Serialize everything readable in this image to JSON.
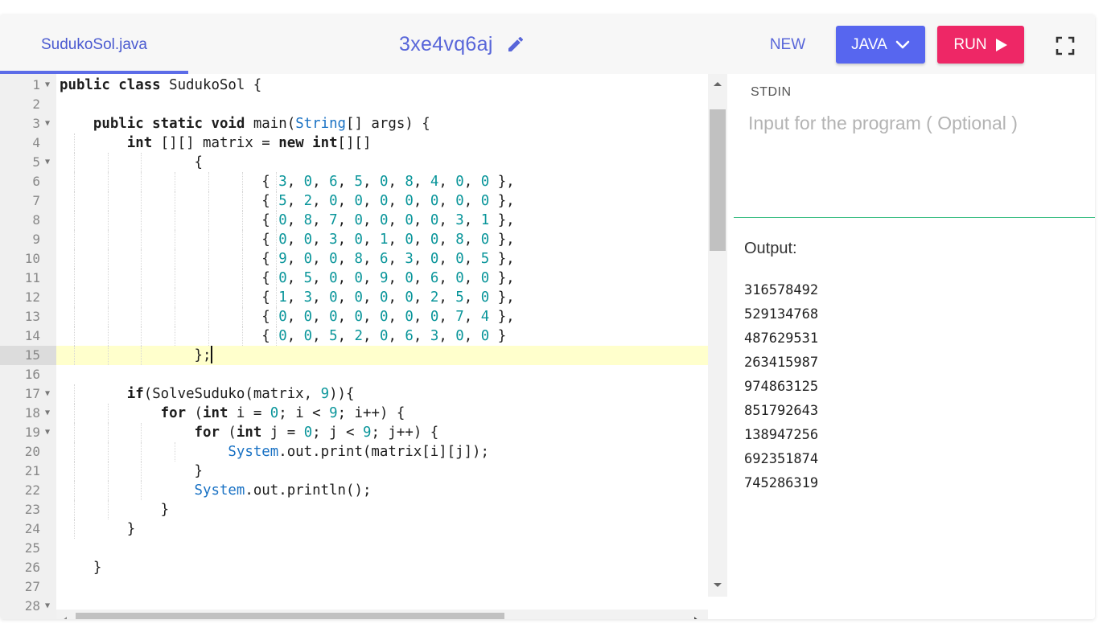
{
  "header": {
    "file_tab": "SudukoSol.java",
    "title": "3xe4vq6aj",
    "new_label": "NEW",
    "language_label": "JAVA",
    "run_label": "RUN"
  },
  "editor": {
    "active_line": 15,
    "lines": [
      {
        "n": "1",
        "fold": true,
        "indent": 0,
        "html": "<span class=\"kw\">public class</span> SudukoSol {"
      },
      {
        "n": "2",
        "fold": false,
        "indent": 0,
        "html": ""
      },
      {
        "n": "3",
        "fold": true,
        "indent": 1,
        "html": "    <span class=\"kw\">public static void</span> main(<span class=\"cls\">String</span>[] args) {"
      },
      {
        "n": "4",
        "fold": false,
        "indent": 2,
        "html": "        <span class=\"kw\">int</span> [][] matrix = <span class=\"kw\">new int</span>[][]"
      },
      {
        "n": "5",
        "fold": true,
        "indent": 4,
        "html": "                {"
      },
      {
        "n": "6",
        "fold": false,
        "indent": 8,
        "html": "                        { <span class=\"num\">3</span>, <span class=\"num\">0</span>, <span class=\"num\">6</span>, <span class=\"num\">5</span>, <span class=\"num\">0</span>, <span class=\"num\">8</span>, <span class=\"num\">4</span>, <span class=\"num\">0</span>, <span class=\"num\">0</span> },"
      },
      {
        "n": "7",
        "fold": false,
        "indent": 8,
        "html": "                        { <span class=\"num\">5</span>, <span class=\"num\">2</span>, <span class=\"num\">0</span>, <span class=\"num\">0</span>, <span class=\"num\">0</span>, <span class=\"num\">0</span>, <span class=\"num\">0</span>, <span class=\"num\">0</span>, <span class=\"num\">0</span> },"
      },
      {
        "n": "8",
        "fold": false,
        "indent": 8,
        "html": "                        { <span class=\"num\">0</span>, <span class=\"num\">8</span>, <span class=\"num\">7</span>, <span class=\"num\">0</span>, <span class=\"num\">0</span>, <span class=\"num\">0</span>, <span class=\"num\">0</span>, <span class=\"num\">3</span>, <span class=\"num\">1</span> },"
      },
      {
        "n": "9",
        "fold": false,
        "indent": 8,
        "html": "                        { <span class=\"num\">0</span>, <span class=\"num\">0</span>, <span class=\"num\">3</span>, <span class=\"num\">0</span>, <span class=\"num\">1</span>, <span class=\"num\">0</span>, <span class=\"num\">0</span>, <span class=\"num\">8</span>, <span class=\"num\">0</span> },"
      },
      {
        "n": "10",
        "fold": false,
        "indent": 8,
        "html": "                        { <span class=\"num\">9</span>, <span class=\"num\">0</span>, <span class=\"num\">0</span>, <span class=\"num\">8</span>, <span class=\"num\">6</span>, <span class=\"num\">3</span>, <span class=\"num\">0</span>, <span class=\"num\">0</span>, <span class=\"num\">5</span> },"
      },
      {
        "n": "11",
        "fold": false,
        "indent": 8,
        "html": "                        { <span class=\"num\">0</span>, <span class=\"num\">5</span>, <span class=\"num\">0</span>, <span class=\"num\">0</span>, <span class=\"num\">9</span>, <span class=\"num\">0</span>, <span class=\"num\">6</span>, <span class=\"num\">0</span>, <span class=\"num\">0</span> },"
      },
      {
        "n": "12",
        "fold": false,
        "indent": 8,
        "html": "                        { <span class=\"num\">1</span>, <span class=\"num\">3</span>, <span class=\"num\">0</span>, <span class=\"num\">0</span>, <span class=\"num\">0</span>, <span class=\"num\">0</span>, <span class=\"num\">2</span>, <span class=\"num\">5</span>, <span class=\"num\">0</span> },"
      },
      {
        "n": "13",
        "fold": false,
        "indent": 8,
        "html": "                        { <span class=\"num\">0</span>, <span class=\"num\">0</span>, <span class=\"num\">0</span>, <span class=\"num\">0</span>, <span class=\"num\">0</span>, <span class=\"num\">0</span>, <span class=\"num\">0</span>, <span class=\"num\">7</span>, <span class=\"num\">4</span> },"
      },
      {
        "n": "14",
        "fold": false,
        "indent": 8,
        "html": "                        { <span class=\"num\">0</span>, <span class=\"num\">0</span>, <span class=\"num\">5</span>, <span class=\"num\">2</span>, <span class=\"num\">0</span>, <span class=\"num\">6</span>, <span class=\"num\">3</span>, <span class=\"num\">0</span>, <span class=\"num\">0</span> }"
      },
      {
        "n": "15",
        "fold": false,
        "indent": 4,
        "html": "                };<span class=\"cursor\"></span>"
      },
      {
        "n": "16",
        "fold": false,
        "indent": 0,
        "html": ""
      },
      {
        "n": "17",
        "fold": true,
        "indent": 2,
        "html": "        <span class=\"kw\">if</span>(SolveSuduko(matrix, <span class=\"num\">9</span>)){"
      },
      {
        "n": "18",
        "fold": true,
        "indent": 3,
        "html": "            <span class=\"kw\">for</span> (<span class=\"kw\">int</span> i = <span class=\"num\">0</span>; i &lt; <span class=\"num\">9</span>; i++) {"
      },
      {
        "n": "19",
        "fold": true,
        "indent": 4,
        "html": "                <span class=\"kw\">for</span> (<span class=\"kw\">int</span> j = <span class=\"num\">0</span>; j &lt; <span class=\"num\">9</span>; j++) {"
      },
      {
        "n": "20",
        "fold": false,
        "indent": 5,
        "html": "                    <span class=\"cls\">System</span>.out.print(matrix[i][j]);"
      },
      {
        "n": "21",
        "fold": false,
        "indent": 4,
        "html": "                }"
      },
      {
        "n": "22",
        "fold": false,
        "indent": 4,
        "html": "                <span class=\"cls\">System</span>.out.println();"
      },
      {
        "n": "23",
        "fold": false,
        "indent": 3,
        "html": "            }"
      },
      {
        "n": "24",
        "fold": false,
        "indent": 2,
        "html": "        }"
      },
      {
        "n": "25",
        "fold": false,
        "indent": 0,
        "html": ""
      },
      {
        "n": "26",
        "fold": false,
        "indent": 1,
        "html": "    }"
      },
      {
        "n": "27",
        "fold": false,
        "indent": 0,
        "html": ""
      },
      {
        "n": "28",
        "fold": true,
        "indent": 0,
        "html": ""
      }
    ]
  },
  "stdin": {
    "label": "STDIN",
    "placeholder": "Input for the program ( Optional )"
  },
  "output": {
    "label": "Output:",
    "lines": [
      "316578492",
      "529134768",
      "487629531",
      "263415987",
      "974863125",
      "851792643",
      "138947256",
      "692351874",
      "745286319"
    ]
  },
  "colors": {
    "accent": "#5766ef",
    "run": "#ee2766",
    "divider": "#3fbf86",
    "active_line": "#ffffcc"
  },
  "icons": {
    "edit": "pencil-icon",
    "language": "chevron-down-icon",
    "run": "play-icon",
    "fullscreen": "fullscreen-icon"
  }
}
